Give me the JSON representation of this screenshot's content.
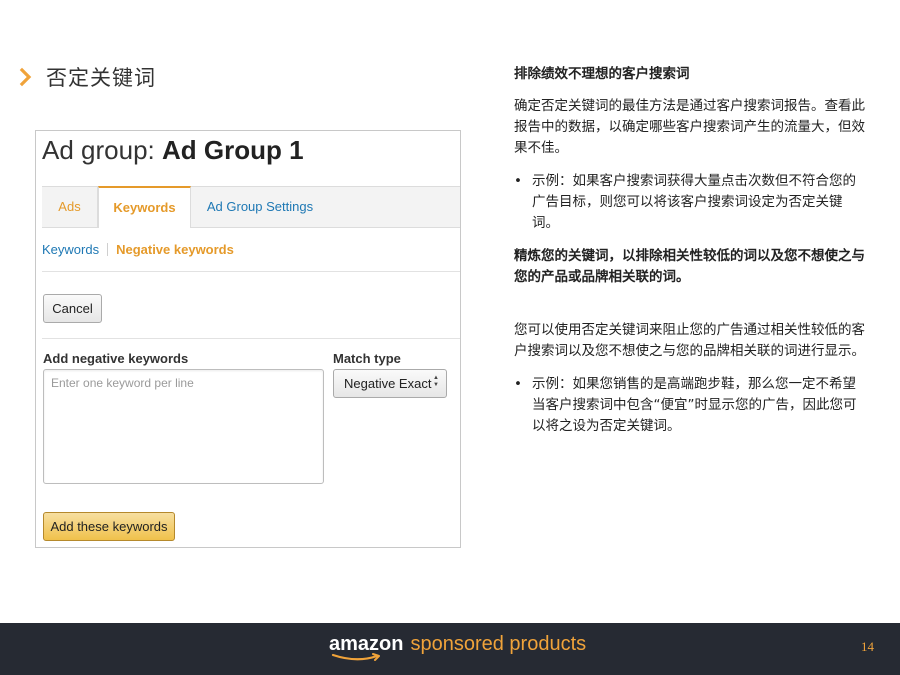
{
  "slide": {
    "title": "否定关键词",
    "accent_color": "#f0a33a"
  },
  "screenshot": {
    "ad_group_prefix": "Ad group: ",
    "ad_group_name": "Ad Group 1",
    "tabs": [
      {
        "label": "Ads",
        "active": false
      },
      {
        "label": "Keywords",
        "active": true
      },
      {
        "label": "Ad Group Settings",
        "active": false
      }
    ],
    "subtabs": {
      "keywords": "Keywords",
      "negative": "Negative keywords"
    },
    "cancel_label": "Cancel",
    "add_negative_label": "Add negative keywords",
    "textarea_placeholder": "Enter one keyword per line",
    "match_type_label": "Match type",
    "match_type_value": "Negative Exact",
    "add_button_label": "Add these keywords"
  },
  "content": {
    "heading1": "排除绩效不理想的客户搜索词",
    "para1": "确定否定关键词的最佳方法是通过客户搜索词报告。查看此报告中的数据，以确定哪些客户搜索词产生的流量大，但效果不佳。",
    "bullet1": "示例：如果客户搜索词获得大量点击次数但不符合您的广告目标，则您可以将该客户搜索词设定为否定关键词。",
    "heading2": "精炼您的关键词，以排除相关性较低的词以及您不想使之与您的产品或品牌相关联的词。",
    "para2": "您可以使用否定关键词来阻止您的广告通过相关性较低的客户搜索词以及您不想使之与您的品牌相关联的词进行显示。",
    "bullet2": "示例：如果您销售的是高端跑步鞋，那么您一定不希望当客户搜索词中包含“便宜”时显示您的广告，因此您可以将之设为否定关键词。",
    "bullet_symbol": "•"
  },
  "footer": {
    "brand_amazon": "amazon",
    "brand_sponsored": "sponsored products",
    "page_number": "14"
  }
}
